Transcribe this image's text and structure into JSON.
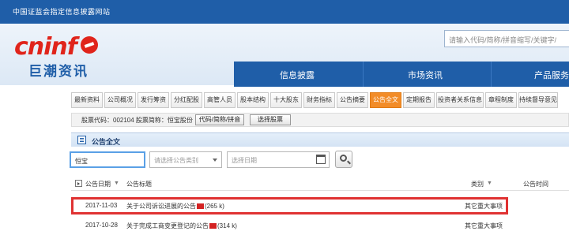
{
  "topbar": {
    "text": "中国证监会指定信息披露网站"
  },
  "logo": {
    "brand": "cninf",
    "name_cn": "巨潮资讯"
  },
  "search": {
    "placeholder": "请输入代码/简称/拼音缩写/关键字/"
  },
  "nav": {
    "items": [
      "信息披露",
      "市场资讯",
      "产品服务"
    ]
  },
  "tabs": [
    "最新资料",
    "公司概况",
    "发行筹资",
    "分红配股",
    "高管人员",
    "股本结构",
    "十大股东",
    "财务指标",
    "公告摘要",
    "公告全文",
    "定期报告",
    "投资者关系信息",
    "章程制度",
    "持续督导意见"
  ],
  "active_tab": "公告全文",
  "codebar": {
    "text": "股票代码：002104 股票简称：恒宝股份",
    "code_btn": "代码/简称/拼音",
    "select_btn": "选择股票"
  },
  "section": {
    "title": "公告全文"
  },
  "filters": {
    "keyword_value": "恒宝",
    "category_placeholder": "请选择公告类别",
    "date_placeholder": "选择日期"
  },
  "table": {
    "headers": {
      "date": "公告日期",
      "title": "公告标题",
      "category": "类别",
      "time": "公告时间"
    },
    "sort_mark": "▼",
    "rows": [
      {
        "date": "2017-11-03",
        "title": "关于公司诉讼进展的公告",
        "size": "(265 k)",
        "category": "其它重大事项"
      },
      {
        "date": "2017-10-28",
        "title": "关于完成工商变更登记的公告",
        "size": "(314 k)",
        "category": "其它重大事项"
      }
    ]
  },
  "colors": {
    "brand_blue": "#1f5ea8",
    "brand_red": "#e0241b",
    "active_tab": "#f28c28",
    "highlight": "#e03232"
  }
}
